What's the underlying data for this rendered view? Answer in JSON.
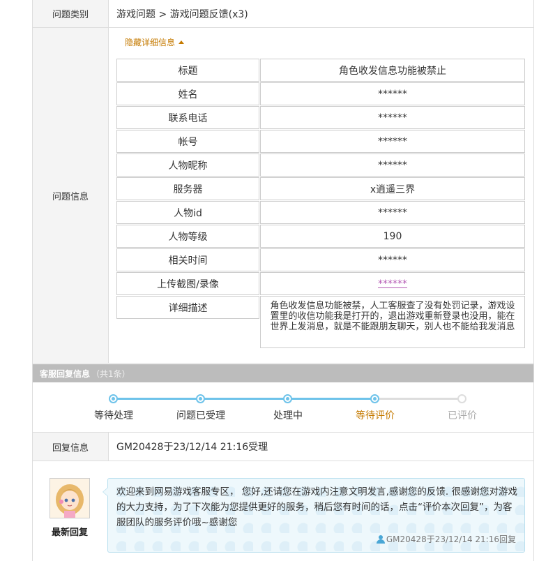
{
  "category": {
    "label": "问题类别",
    "value": "游戏问题 > 游戏问题反馈(x3)"
  },
  "issue_info": {
    "label": "问题信息",
    "toggle_label": "隐藏详细信息",
    "fields": [
      {
        "key": "标题",
        "value": "角色收发信息功能被禁止"
      },
      {
        "key": "姓名",
        "value": "******"
      },
      {
        "key": "联系电话",
        "value": "******"
      },
      {
        "key": "帐号",
        "value": "******"
      },
      {
        "key": "人物昵称",
        "value": "******"
      },
      {
        "key": "服务器",
        "value": "x逍遥三界"
      },
      {
        "key": "人物id",
        "value": "******"
      },
      {
        "key": "人物等级",
        "value": "190"
      },
      {
        "key": "相关时间",
        "value": "******"
      },
      {
        "key": "上传截图/录像",
        "value": "******"
      },
      {
        "key": "详细描述",
        "value": "角色收发信息功能被禁，人工客服查了没有处罚记录，游戏设置里的收信功能我是打开的，退出游戏重新登录也没用，能在世界上发消息，就是不能跟朋友聊天，别人也不能给我发消息"
      }
    ]
  },
  "service": {
    "title": "客服回复信息",
    "count": "（共1条）",
    "steps": [
      {
        "label": "等待处理",
        "state": "done"
      },
      {
        "label": "问题已受理",
        "state": "done"
      },
      {
        "label": "处理中",
        "state": "done"
      },
      {
        "label": "等待评价",
        "state": "current"
      },
      {
        "label": "已评价",
        "state": "pending"
      }
    ],
    "reply_info": {
      "label": "回复信息",
      "value": "GM20428于23/12/14 21:16受理"
    },
    "latest": {
      "label": "最新回复",
      "message": "欢迎来到网易游戏客服专区， 您好,还请您在游戏内注意文明发言,感谢您的反馈. 很感谢您对游戏的大力支持，为了下次能为您提供更好的服务，稍后您有时间的话，点击“评价本次回复”，为客服团队的服务评价哦~感谢您",
      "meta": "GM20428于23/12/14 21:16回复"
    }
  },
  "colors": {
    "accent": "#c57a00",
    "progress": "#6ec3ea",
    "link": "#b45ab4"
  }
}
